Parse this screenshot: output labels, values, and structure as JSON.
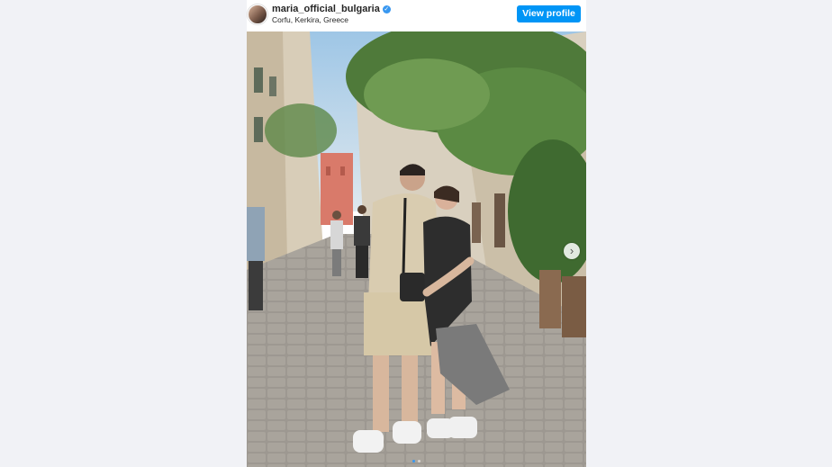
{
  "post": {
    "username": "maria_official_bulgaria",
    "verified_icon": "verified-badge-icon",
    "location": "Corfu, Kerkira, Greece",
    "view_profile_label": "View profile",
    "accent_color": "#0095f6",
    "carousel": {
      "next_icon": "chevron-right-icon",
      "dot_count": 2,
      "active_index": 0
    }
  }
}
